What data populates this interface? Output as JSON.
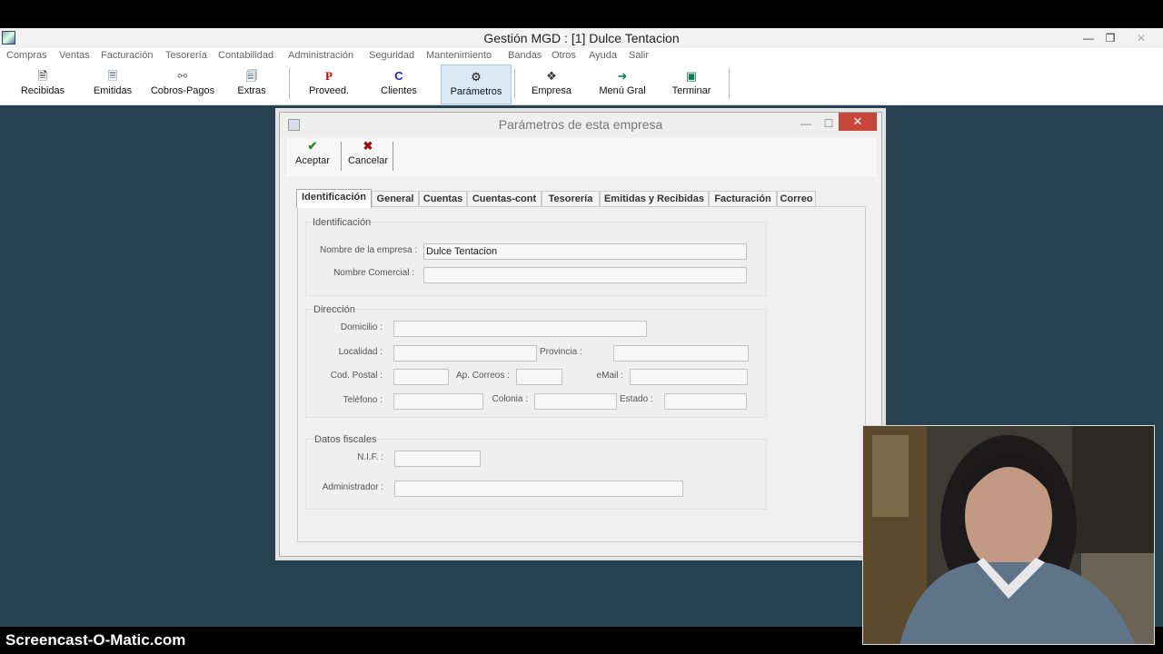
{
  "window": {
    "title": "Gestión MGD  : [1] Dulce Tentacion"
  },
  "menu": [
    "Compras",
    "Ventas",
    "Facturación",
    "Tesorería",
    "Contabilidad",
    "Administración",
    "Seguridad",
    "Mantenimiento",
    "Bandas",
    "Otros",
    "Ayuda",
    "Salir"
  ],
  "toolbar": [
    {
      "label": "Recibidas",
      "icon": "inbox-doc-icon"
    },
    {
      "label": "Emitidas",
      "icon": "outbox-doc-icon"
    },
    {
      "label": "Cobros-Pagos",
      "icon": "coins-icon"
    },
    {
      "label": "Extras",
      "icon": "extras-doc-icon"
    },
    {
      "label": "Proveed.",
      "icon": "letter-p-icon"
    },
    {
      "label": "Clientes",
      "icon": "letter-c-icon"
    },
    {
      "label": "Parámetros",
      "icon": "gear-icon"
    },
    {
      "label": "Empresa",
      "icon": "network-icon"
    },
    {
      "label": "Menú Gral",
      "icon": "arrow-right-icon"
    },
    {
      "label": "Terminar",
      "icon": "exit-door-icon"
    }
  ],
  "dialog": {
    "title": "Parámetros de esta empresa",
    "accept_label": "Aceptar",
    "cancel_label": "Cancelar",
    "tabs": [
      "Identificación",
      "General",
      "Cuentas",
      "Cuentas-cont",
      "Tesorería",
      "Emitidas y Recibidas",
      "Facturación",
      "Correo"
    ],
    "identificacion": {
      "group_label": "Identificación",
      "nombre_empresa_label": "Nombre de la empresa :",
      "nombre_empresa_value": "Dulce Tentacion",
      "nombre_comercial_label": "Nombre Comercial :",
      "nombre_comercial_value": ""
    },
    "direccion": {
      "group_label": "Dirección",
      "domicilio_label": "Domicilio :",
      "localidad_label": "Localidad :",
      "provincia_label": "Provincia :",
      "cod_postal_label": "Cod. Postal :",
      "ap_correos_label": "Ap. Correos :",
      "email_label": "eMail :",
      "telefono_label": "Teléfono :",
      "colonia_label": "Colonia :",
      "estado_label": "Estado :"
    },
    "fiscales": {
      "group_label": "Datos fiscales",
      "nif_label": "N.I.F. :",
      "administrador_label": "Administrador :"
    }
  },
  "watermark": "Screencast-O-Matic.com"
}
